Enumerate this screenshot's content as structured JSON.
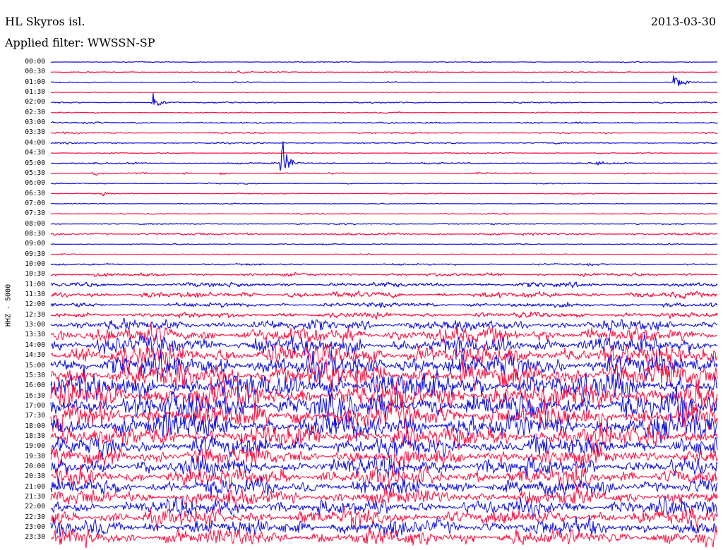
{
  "header": {
    "station": "HL Skyros isl.",
    "filter": "Applied filter: WWSSN-SP",
    "date": "2013-03-30"
  },
  "chart_data": {
    "type": "line",
    "title": "HL Skyros isl.",
    "subtitle": "Applied filter: WWSSN-SP",
    "date": "2013-03-30",
    "ylabel": "HHZ - 5000",
    "colors": {
      "even": "#1010e0",
      "odd": "#ff1040"
    },
    "rows": [
      {
        "time": "00:00",
        "amp": 0.5
      },
      {
        "time": "00:30",
        "amp": 0.6
      },
      {
        "time": "01:00",
        "amp": 0.6
      },
      {
        "time": "01:30",
        "amp": 0.5
      },
      {
        "time": "02:00",
        "amp": 0.8
      },
      {
        "time": "02:30",
        "amp": 0.6
      },
      {
        "time": "03:00",
        "amp": 0.9
      },
      {
        "time": "03:30",
        "amp": 0.9
      },
      {
        "time": "04:00",
        "amp": 0.8
      },
      {
        "time": "04:30",
        "amp": 0.6
      },
      {
        "time": "05:00",
        "amp": 0.9
      },
      {
        "time": "05:30",
        "amp": 0.8
      },
      {
        "time": "06:00",
        "amp": 0.6
      },
      {
        "time": "06:30",
        "amp": 0.6
      },
      {
        "time": "07:00",
        "amp": 0.5
      },
      {
        "time": "07:30",
        "amp": 0.6
      },
      {
        "time": "08:00",
        "amp": 0.8
      },
      {
        "time": "08:30",
        "amp": 1.2
      },
      {
        "time": "09:00",
        "amp": 0.6
      },
      {
        "time": "09:30",
        "amp": 0.6
      },
      {
        "time": "10:00",
        "amp": 1.0
      },
      {
        "time": "10:30",
        "amp": 1.8
      },
      {
        "time": "11:00",
        "amp": 2.5
      },
      {
        "time": "11:30",
        "amp": 3.2
      },
      {
        "time": "12:00",
        "amp": 2.5
      },
      {
        "time": "12:30",
        "amp": 3.0
      },
      {
        "time": "13:00",
        "amp": 6
      },
      {
        "time": "13:30",
        "amp": 9
      },
      {
        "time": "14:00",
        "amp": 10
      },
      {
        "time": "14:30",
        "amp": 12
      },
      {
        "time": "15:00",
        "amp": 13
      },
      {
        "time": "15:30",
        "amp": 14
      },
      {
        "time": "16:00",
        "amp": 15
      },
      {
        "time": "16:30",
        "amp": 15
      },
      {
        "time": "17:00",
        "amp": 15
      },
      {
        "time": "17:30",
        "amp": 14
      },
      {
        "time": "18:00",
        "amp": 14
      },
      {
        "time": "18:30",
        "amp": 12
      },
      {
        "time": "19:00",
        "amp": 11
      },
      {
        "time": "19:30",
        "amp": 10
      },
      {
        "time": "20:00",
        "amp": 10
      },
      {
        "time": "20:30",
        "amp": 10
      },
      {
        "time": "21:00",
        "amp": 9
      },
      {
        "time": "21:30",
        "amp": 9
      },
      {
        "time": "22:00",
        "amp": 9
      },
      {
        "time": "22:30",
        "amp": 9
      },
      {
        "time": "23:00",
        "amp": 9
      },
      {
        "time": "23:30",
        "amp": 9
      }
    ],
    "events": [
      {
        "row": "00:30",
        "minute": 22,
        "amp": 3
      },
      {
        "row": "01:00",
        "minute": 73,
        "amp": 14
      },
      {
        "row": "02:00",
        "minute": 12,
        "amp": 10
      },
      {
        "row": "05:00",
        "minute": 27,
        "amp": 28
      },
      {
        "row": "05:00",
        "minute": 64,
        "amp": 5
      },
      {
        "row": "05:30",
        "minute": 5,
        "amp": 3
      },
      {
        "row": "05:30",
        "minute": 20,
        "amp": 3
      },
      {
        "row": "06:30",
        "minute": 6,
        "amp": 4
      }
    ]
  }
}
